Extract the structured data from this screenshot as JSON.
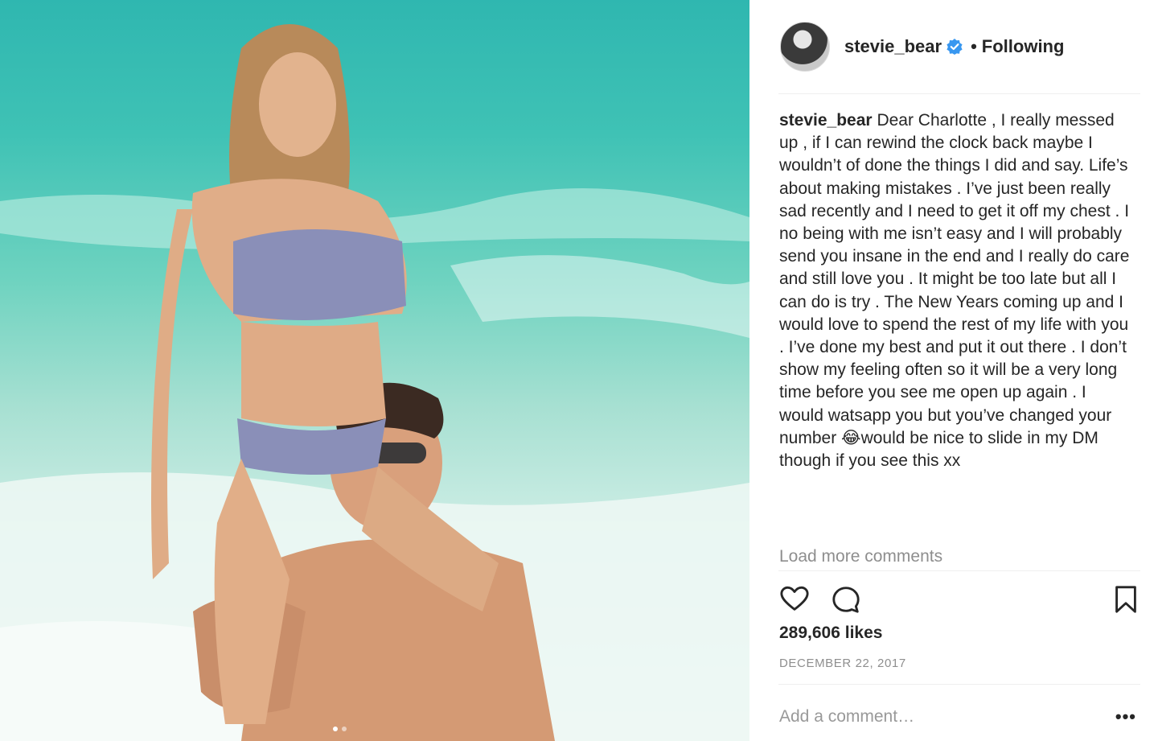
{
  "post": {
    "header": {
      "username": "stevie_bear",
      "separator": "•",
      "follow_status": "Following"
    },
    "caption": {
      "username": "stevie_bear",
      "text": "Dear Charlotte , I really messed up , if I can rewind the clock back maybe I wouldn’t of done the things I did and say. Life’s about making mistakes . I’ve just been really sad recently and I need to get it off my chest . I no being with me isn’t easy and I will probably send you insane in the end and I really do care and still love you . It might be too late but all I can do is try . The New Years coming up and I would love to spend the rest of my life with you . I’ve done my best and put it out there . I don’t show my feeling often so it will be a very long time before you see me open up again . I would watsapp you but you’ve changed your number 😂would be nice to slide in my DM though if you see this xx"
    },
    "load_more": "Load more comments",
    "likes": "289,606 likes",
    "date": "DECEMBER 22, 2017",
    "comment_placeholder": "Add a comment…",
    "more_options": "•••"
  },
  "icons": {
    "heart": "heart-icon",
    "comment": "comment-icon",
    "bookmark": "bookmark-icon",
    "verified": "verified-badge-icon"
  },
  "colors": {
    "text": "#262626",
    "secondary": "#8e8e8e",
    "verified": "#3897f0",
    "divider": "#efefef"
  },
  "carousel": {
    "count": 2,
    "active": 0
  }
}
